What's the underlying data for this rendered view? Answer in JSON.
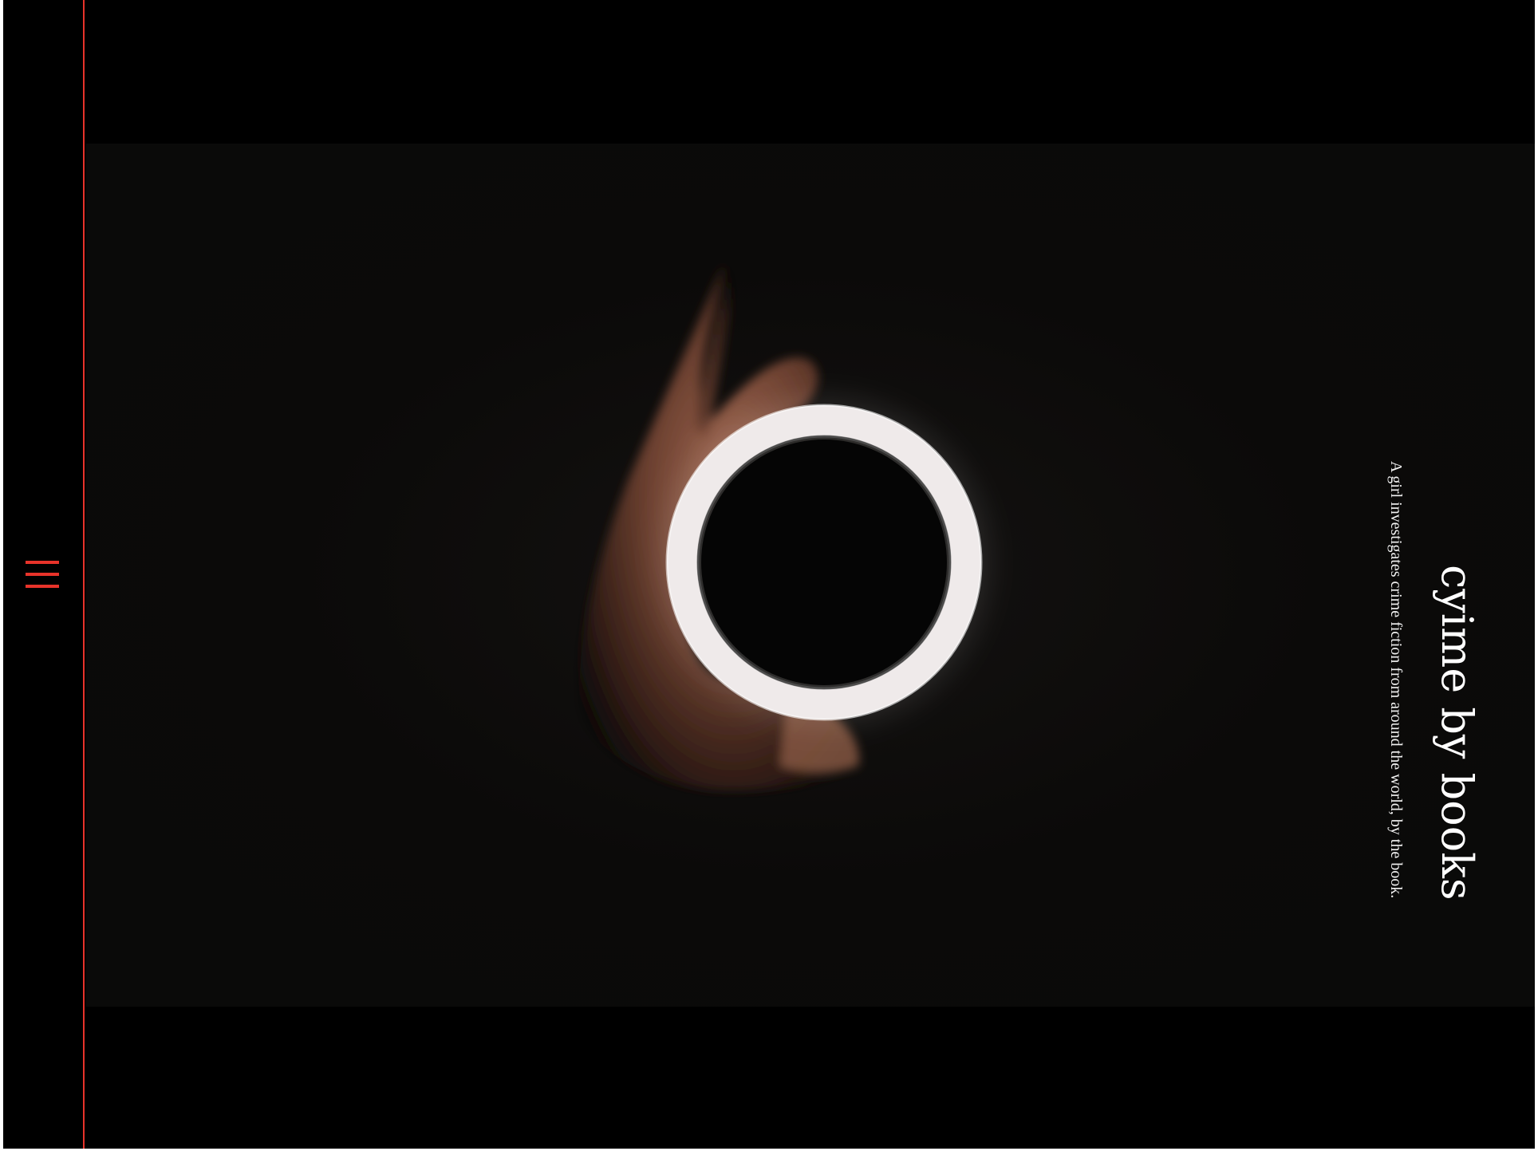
{
  "sidebar": {
    "menu_icon": "hamburger-menu-icon",
    "accent_color": "#e8332a"
  },
  "hero": {
    "image": "hand-holding-glowing-ring",
    "background_color": "#0b0a09"
  },
  "site": {
    "title": "cyime by books",
    "tagline": "A girl investigates crime fiction from around the world, by the book."
  }
}
